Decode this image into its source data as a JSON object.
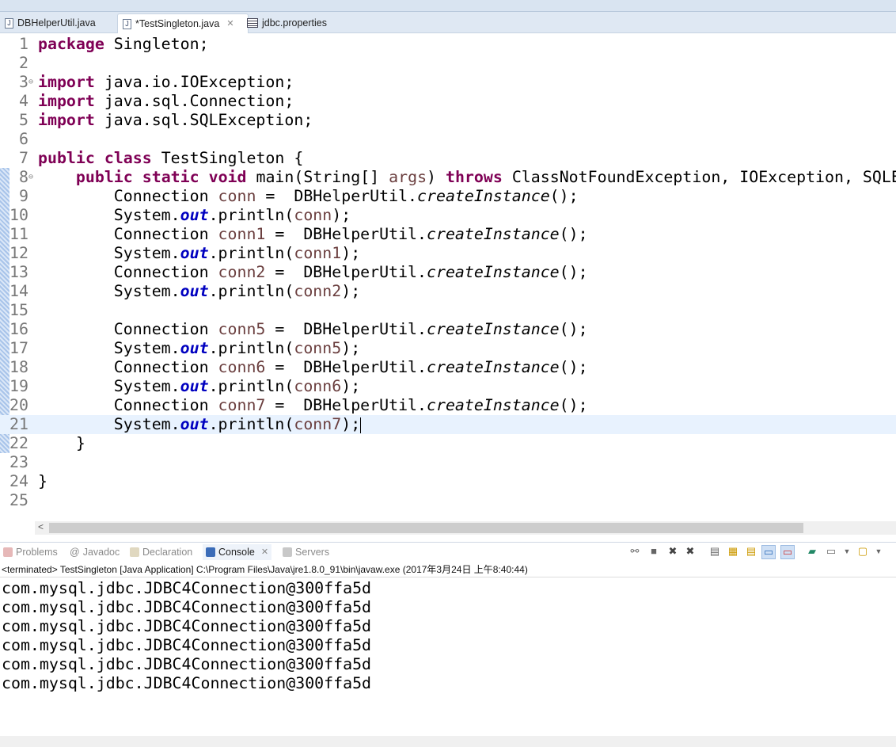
{
  "tabs": [
    {
      "label": "DBHelperUtil.java"
    },
    {
      "label": "*TestSingleton.java"
    },
    {
      "label": "jdbc.properties"
    }
  ],
  "editor": {
    "lines": [
      [
        [
          "package",
          "kw"
        ],
        [
          " Singleton;",
          ""
        ]
      ],
      [],
      [
        [
          "import",
          "kw"
        ],
        [
          " java.io.IOException;",
          ""
        ]
      ],
      [
        [
          "import",
          "kw"
        ],
        [
          " java.sql.Connection;",
          ""
        ]
      ],
      [
        [
          "import",
          "kw"
        ],
        [
          " java.sql.SQLException;",
          ""
        ]
      ],
      [],
      [
        [
          "public",
          "kw"
        ],
        [
          " ",
          ""
        ],
        [
          "class",
          "kw"
        ],
        [
          " TestSingleton {",
          ""
        ]
      ],
      [
        [
          "    ",
          ""
        ],
        [
          "public",
          "kw"
        ],
        [
          " ",
          ""
        ],
        [
          "static",
          "kw"
        ],
        [
          " ",
          ""
        ],
        [
          "void",
          "kw"
        ],
        [
          " main(String[] ",
          ""
        ],
        [
          "args",
          "var"
        ],
        [
          ") ",
          ""
        ],
        [
          "throws",
          "kw"
        ],
        [
          " ClassNotFoundException, IOException, SQLException {",
          ""
        ]
      ],
      [
        [
          "        Connection ",
          ""
        ],
        [
          "conn",
          "var"
        ],
        [
          " =  DBHelperUtil.",
          ""
        ],
        [
          "createInstance",
          "sm"
        ],
        [
          "();",
          ""
        ]
      ],
      [
        [
          "        System.",
          ""
        ],
        [
          "out",
          "fld"
        ],
        [
          ".println(",
          ""
        ],
        [
          "conn",
          "var"
        ],
        [
          ");",
          ""
        ]
      ],
      [
        [
          "        Connection ",
          ""
        ],
        [
          "conn1",
          "var"
        ],
        [
          " =  DBHelperUtil.",
          ""
        ],
        [
          "createInstance",
          "sm"
        ],
        [
          "();",
          ""
        ]
      ],
      [
        [
          "        System.",
          ""
        ],
        [
          "out",
          "fld"
        ],
        [
          ".println(",
          ""
        ],
        [
          "conn1",
          "var"
        ],
        [
          ");",
          ""
        ]
      ],
      [
        [
          "        Connection ",
          ""
        ],
        [
          "conn2",
          "var"
        ],
        [
          " =  DBHelperUtil.",
          ""
        ],
        [
          "createInstance",
          "sm"
        ],
        [
          "();",
          ""
        ]
      ],
      [
        [
          "        System.",
          ""
        ],
        [
          "out",
          "fld"
        ],
        [
          ".println(",
          ""
        ],
        [
          "conn2",
          "var"
        ],
        [
          ");",
          ""
        ]
      ],
      [],
      [
        [
          "        Connection ",
          ""
        ],
        [
          "conn5",
          "var"
        ],
        [
          " =  DBHelperUtil.",
          ""
        ],
        [
          "createInstance",
          "sm"
        ],
        [
          "();",
          ""
        ]
      ],
      [
        [
          "        System.",
          ""
        ],
        [
          "out",
          "fld"
        ],
        [
          ".println(",
          ""
        ],
        [
          "conn5",
          "var"
        ],
        [
          ");",
          ""
        ]
      ],
      [
        [
          "        Connection ",
          ""
        ],
        [
          "conn6",
          "var"
        ],
        [
          " =  DBHelperUtil.",
          ""
        ],
        [
          "createInstance",
          "sm"
        ],
        [
          "();",
          ""
        ]
      ],
      [
        [
          "        System.",
          ""
        ],
        [
          "out",
          "fld"
        ],
        [
          ".println(",
          ""
        ],
        [
          "conn6",
          "var"
        ],
        [
          ");",
          ""
        ]
      ],
      [
        [
          "        Connection ",
          ""
        ],
        [
          "conn7",
          "var"
        ],
        [
          " =  DBHelperUtil.",
          ""
        ],
        [
          "createInstance",
          "sm"
        ],
        [
          "();",
          ""
        ]
      ],
      [
        [
          "        System.",
          ""
        ],
        [
          "out",
          "fld"
        ],
        [
          ".println(",
          ""
        ],
        [
          "conn7",
          "var"
        ],
        [
          ");",
          ""
        ]
      ],
      [
        [
          "    }",
          ""
        ]
      ],
      [],
      [
        [
          "}",
          ""
        ]
      ],
      []
    ],
    "current_line": 21,
    "folded_lines": [
      3,
      8
    ]
  },
  "panel": {
    "tabs": [
      {
        "label": "Problems",
        "icon": "problems-icon"
      },
      {
        "label": "Javadoc",
        "icon": "at-icon"
      },
      {
        "label": "Declaration",
        "icon": "declaration-icon"
      },
      {
        "label": "Console",
        "icon": "console-icon"
      },
      {
        "label": "Servers",
        "icon": "servers-icon"
      }
    ],
    "status": "<terminated> TestSingleton [Java Application] C:\\Program Files\\Java\\jre1.8.0_91\\bin\\javaw.exe (2017年3月24日 上午8:40:44)",
    "output": [
      "com.mysql.jdbc.JDBC4Connection@300ffa5d",
      "com.mysql.jdbc.JDBC4Connection@300ffa5d",
      "com.mysql.jdbc.JDBC4Connection@300ffa5d",
      "com.mysql.jdbc.JDBC4Connection@300ffa5d",
      "com.mysql.jdbc.JDBC4Connection@300ffa5d",
      "com.mysql.jdbc.JDBC4Connection@300ffa5d"
    ]
  }
}
